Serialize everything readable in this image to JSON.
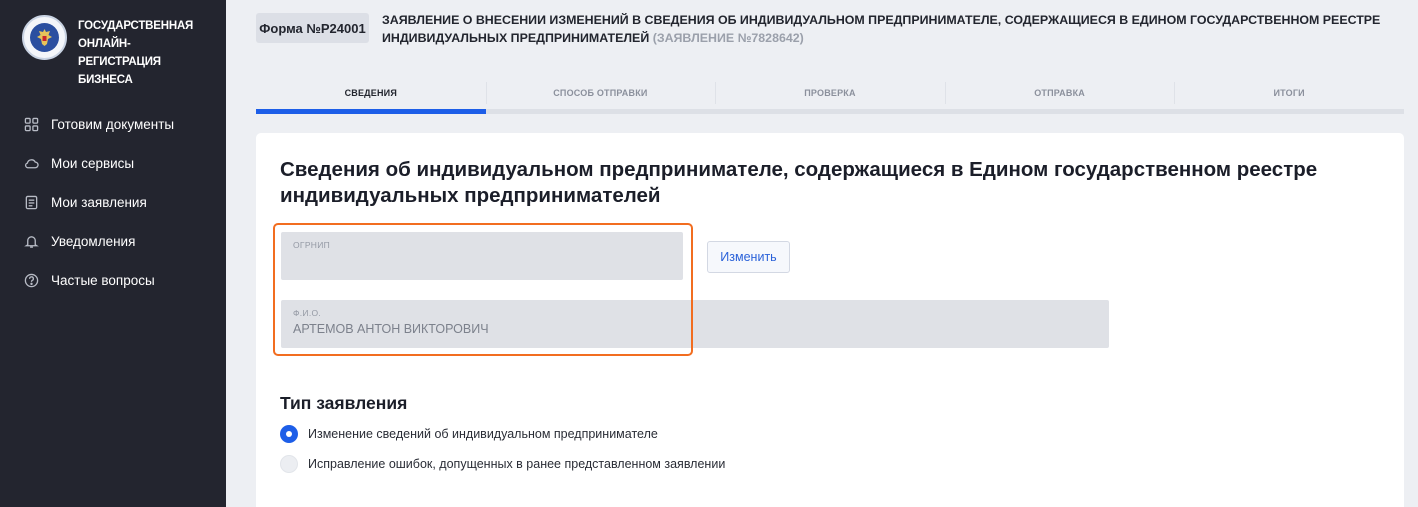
{
  "sidebar": {
    "brand_text": "ГОСУДАРСТВЕННАЯ ОНЛАЙН-РЕГИСТРАЦИЯ БИЗНЕСА",
    "items": [
      {
        "label": "Готовим документы",
        "icon": "grid-icon"
      },
      {
        "label": "Мои сервисы",
        "icon": "cloud-icon"
      },
      {
        "label": "Мои заявления",
        "icon": "document-icon"
      },
      {
        "label": "Уведомления",
        "icon": "bell-icon"
      },
      {
        "label": "Частые вопросы",
        "icon": "question-icon"
      }
    ]
  },
  "header": {
    "form_badge": "Форма №Р24001",
    "title": "ЗАЯВЛЕНИЕ О ВНЕСЕНИИ ИЗМЕНЕНИЙ В СВЕДЕНИЯ ОБ ИНДИВИДУАЛЬНОМ ПРЕДПРИНИМАТЕЛЕ, СОДЕРЖАЩИЕСЯ В ЕДИНОМ ГОСУДАРСТВЕННОМ РЕЕСТРЕ ИНДИВИДУАЛЬНЫХ ПРЕДПРИНИМАТЕЛЕЙ",
    "application_number": "(ЗАЯВЛЕНИЕ №7828642)"
  },
  "steps": [
    {
      "label": "СВЕДЕНИЯ",
      "active": true
    },
    {
      "label": "СПОСОБ ОТПРАВКИ",
      "active": false
    },
    {
      "label": "ПРОВЕРКА",
      "active": false
    },
    {
      "label": "ОТПРАВКА",
      "active": false
    },
    {
      "label": "ИТОГИ",
      "active": false
    }
  ],
  "card": {
    "title": "Сведения об индивидуальном предпринимателе, содержащиеся в Едином государственном реестре индивидуальных предпринимателей",
    "ogrnip": {
      "label": "ОГРНИП",
      "value": ""
    },
    "fio": {
      "label": "Ф.И.О.",
      "value": "АРТЕМОВ АНТОН ВИКТОРОВИЧ"
    },
    "change_button": "Изменить",
    "type_title": "Тип заявления",
    "options": [
      {
        "label": "Изменение сведений об индивидуальном предпринимателе",
        "selected": true
      },
      {
        "label": "Исправление ошибок, допущенных в ранее представленном заявлении",
        "selected": false
      }
    ]
  },
  "colors": {
    "sidebar_bg": "#23252f",
    "accent": "#1d5ee8",
    "highlight": "#f26d20",
    "page_bg": "#edeff3"
  }
}
